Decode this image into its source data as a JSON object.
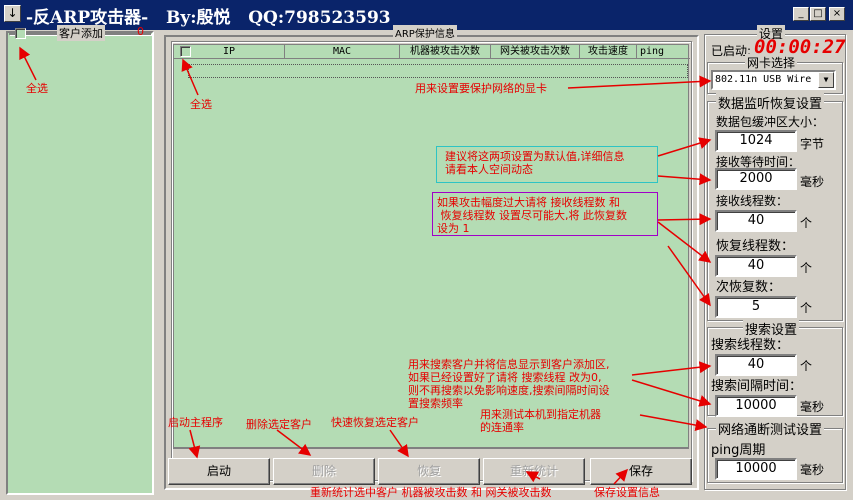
{
  "window": {
    "title": "-反ARP攻击器-   By:殷悦   QQ:798523593",
    "sys_glyph": "↓",
    "min_glyph": "_",
    "max_glyph": "□",
    "close_glyph": "×"
  },
  "left_panel": {
    "title": "客户添加",
    "count": "0"
  },
  "main_panel": {
    "title": "ARP保护信息",
    "columns": [
      "IP",
      "MAC",
      "机器被攻击次数",
      "网关被攻击次数",
      "攻击速度",
      "ping"
    ]
  },
  "settings": {
    "title": "设置",
    "started_label": "已启动:",
    "elapsed": "00:00:27",
    "nic_title": "网卡选择",
    "nic_value": "802.11n USB Wire",
    "recovery_title": "数据监听恢复设置",
    "buffer_label": "数据包缓冲区大小：",
    "buffer_value": "1024",
    "buffer_unit": "字节",
    "wait_label": "接收等待时间：",
    "wait_value": "2000",
    "wait_unit": "毫秒",
    "recv_threads_label": "接收线程数：",
    "recv_threads_value": "40",
    "recv_threads_unit": "个",
    "recover_threads_label": "恢复线程数：",
    "recover_threads_value": "40",
    "recover_threads_unit": "个",
    "recover_times_label": "次恢复数：",
    "recover_times_value": "5",
    "recover_times_unit": "个",
    "search_title": "搜索设置",
    "search_threads_label": "搜索线程数：",
    "search_threads_value": "40",
    "search_threads_unit": "个",
    "search_interval_label": "搜索间隔时间：",
    "search_interval_value": "10000",
    "search_interval_unit": "毫秒",
    "net_test_title": "网络通断测试设置",
    "ping_label": "ping周期",
    "ping_value": "10000",
    "ping_unit": "毫秒"
  },
  "buttons": {
    "start": "启动",
    "delete": "删除",
    "recover": "恢复",
    "recount": "重新统计",
    "save": "保存"
  },
  "annotations": {
    "select_all_left": "全选",
    "select_all_main": "全选",
    "nic_note": "用来设置要保护网络的显卡",
    "default_note": "建议将这两项设置为默认值,详细信息\n请看本人空间动态",
    "thread_note": "如果攻击幅度过大请将 接收线程数 和\n 恢复线程数 设置尽可能大,将 此恢复数\n设为 1",
    "search_note": "用来搜索客户并将信息显示到客户添加区,\n如果已经设置好了请将 搜索线程 改为0,\n则不再搜索以免影响速度,搜索间隔时间设\n置搜索频率",
    "ping_note": "用来测试本机到指定机器\n的连通率",
    "start_note": "启动主程序",
    "delete_note": "删除选定客户",
    "recover_note": "快速恢复选定客户",
    "recount_note": "重新统计选中客户 机器被攻击数 和 网关被攻击数",
    "save_note": "保存设置信息"
  },
  "colors": {
    "titlebar": "#0a246a",
    "list_bg": "#b4dcb4",
    "annotation": "#e60000",
    "timer": "#e60000"
  }
}
